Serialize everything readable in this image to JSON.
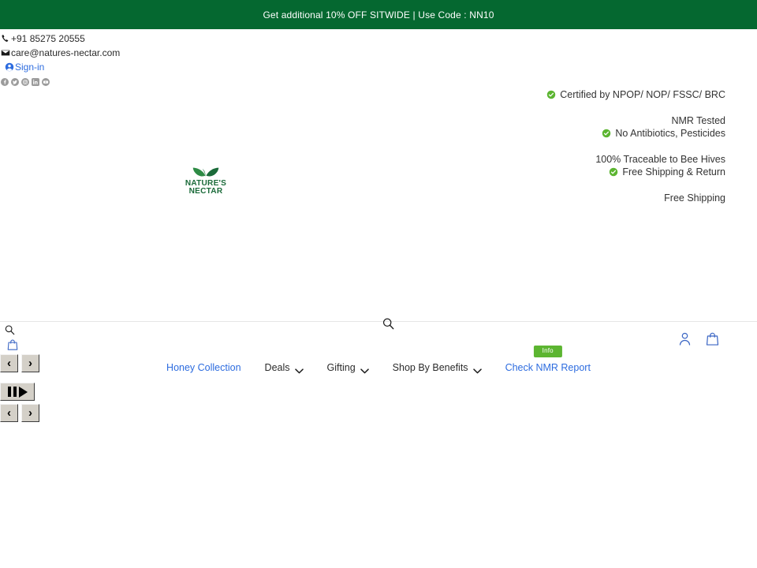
{
  "promo": {
    "text": "Get additional 10% OFF SITWIDE | Use Code : NN10",
    "background": "#056830"
  },
  "contact": {
    "phone": "+91 85275 20555",
    "phone_icon": "phone-icon",
    "email": "care@natures-nectar.com",
    "email_icon": "envelope-icon",
    "signin_label": "Sign-in",
    "signin_icon": "user-circle-icon",
    "signin_color": "#2d6cdf",
    "social": [
      {
        "name": "facebook-icon",
        "label": "Facebook"
      },
      {
        "name": "twitter-icon",
        "label": "Twitter"
      },
      {
        "name": "instagram-icon",
        "label": "Instagram"
      },
      {
        "name": "linkedin-icon",
        "label": "LinkedIn"
      },
      {
        "name": "youtube-icon",
        "label": "YouTube"
      }
    ]
  },
  "usp": {
    "lines": [
      {
        "text": "Certified by NPOP/ NOP/ FSSC/ BRC",
        "check": true
      },
      {
        "text": "",
        "check": false
      },
      {
        "text": "NMR Tested",
        "check": false
      },
      {
        "text": "No Antibiotics, Pesticides",
        "check": true
      },
      {
        "text": "",
        "check": false
      },
      {
        "text": "100% Traceable to Bee Hives",
        "check": false
      },
      {
        "text": "Free Shipping & Return",
        "check": true
      },
      {
        "text": "",
        "check": false
      },
      {
        "text": "Free Shipping",
        "check": false
      }
    ],
    "check_color": "#5cb531"
  },
  "brand": {
    "name_line1": "NATURE'S",
    "name_line2": "NECTAR",
    "logo_color": "#1b6b3a",
    "leaf_color": "#2e8b45"
  },
  "header_icons": {
    "search_icon": "search-icon",
    "account_icon": "account-person-icon",
    "cart_icon": "shopping-bag-icon",
    "icon_color": "#3b66c4"
  },
  "nav": {
    "items": [
      {
        "label": "Honey Collection",
        "type": "link",
        "chevron": false,
        "badge": null
      },
      {
        "label": "Deals",
        "type": "menu",
        "chevron": true,
        "badge": null
      },
      {
        "label": "Gifting",
        "type": "menu",
        "chevron": true,
        "badge": null
      },
      {
        "label": "Shop By Benefits",
        "type": "menu",
        "chevron": true,
        "badge": null
      },
      {
        "label": "Check NMR Report",
        "type": "link",
        "chevron": false,
        "badge": "Info"
      }
    ],
    "link_color": "#2d6cdf",
    "badge_color": "#5cb531"
  },
  "fallback_controls": {
    "search_icon": "search-icon",
    "cart_icon": "shopping-bag-icon",
    "carousel_top": {
      "prev": "‹",
      "next": "›"
    },
    "carousel_play": {
      "pause": "pause-icon",
      "play": "play-icon"
    },
    "carousel_bottom": {
      "prev": "‹",
      "next": "›"
    }
  }
}
